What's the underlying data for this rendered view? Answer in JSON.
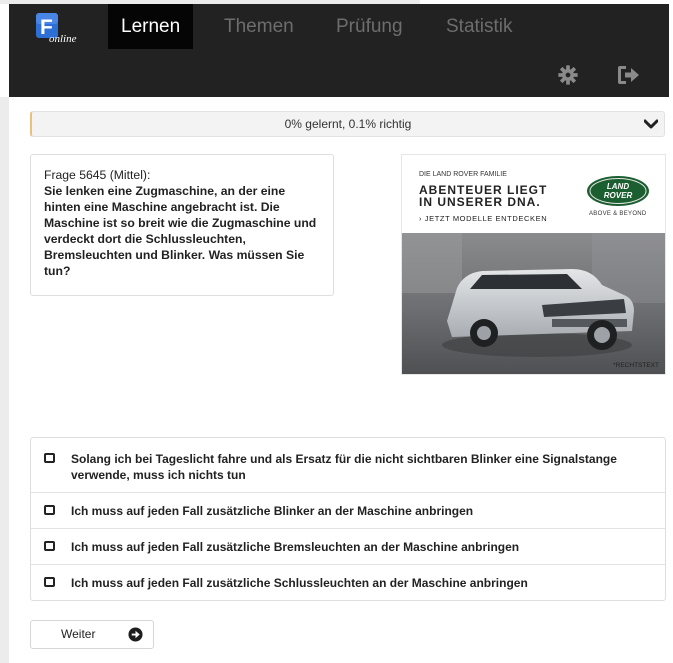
{
  "app": {
    "logo_letter": "F",
    "logo_text": "online"
  },
  "nav": {
    "tabs": [
      {
        "label": "Lernen",
        "active": true
      },
      {
        "label": "Themen",
        "active": false
      },
      {
        "label": "Prüfung",
        "active": false
      },
      {
        "label": "Statistik",
        "active": false
      }
    ],
    "icons": [
      "gear-icon",
      "logout-icon"
    ]
  },
  "progress": {
    "text": "0% gelernt, 0.1% richtig",
    "icon": "chevron-down-icon"
  },
  "question": {
    "id_text": "Frage 5645 (Mittel):",
    "text": "Sie lenken eine Zugmaschine, an der eine hinten eine Maschine angebracht ist. Die Maschine ist so breit wie die Zugmaschine und verdeckt dort die Schlussleuchten, Bremsleuchten und Blinker. Was müssen Sie tun?"
  },
  "ad": {
    "family": "DIE LAND ROVER FAMILIE",
    "headline_line1": "ABENTEUER LIEGT",
    "headline_line2": "IN UNSERER DNA.",
    "cta": "› JETZT MODELLE ENTDECKEN",
    "brand_line1": "LAND",
    "brand_line2": "ROVER",
    "motto": "ABOVE & BEYOND",
    "legal": "*RECHTSTEXT"
  },
  "answers": [
    {
      "text": "Solang ich bei Tageslicht fahre und als Ersatz für die nicht sichtbaren Blinker eine Signalstange verwende, muss ich nichts tun",
      "checked": false
    },
    {
      "text": "Ich muss auf jeden Fall zusätzliche Blinker an der Maschine anbringen",
      "checked": false
    },
    {
      "text": "Ich muss auf jeden Fall zusätzliche Bremsleuchten an der Maschine anbringen",
      "checked": false
    },
    {
      "text": "Ich muss auf jeden Fall zusätzliche Schlussleuchten an der Maschine anbringen",
      "checked": false
    }
  ],
  "next_button": {
    "label": "Weiter",
    "icon": "arrow-right-circle-icon"
  },
  "colors": {
    "nav_bg": "#222222",
    "active_tab_bg": "#050505",
    "logo_blue": "#1d5fbf",
    "progress_accent": "#e8c27a"
  }
}
